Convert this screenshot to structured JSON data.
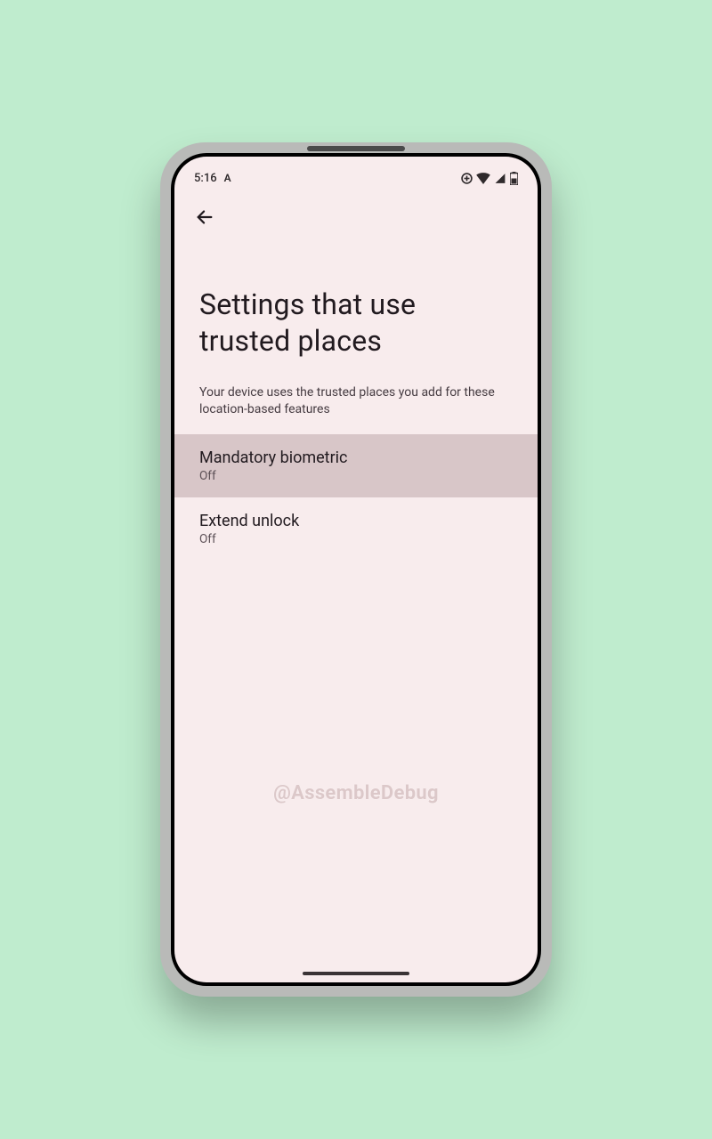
{
  "statusbar": {
    "time": "5:16",
    "carrier_glyph": "A"
  },
  "appbar": {
    "back_label": "Back"
  },
  "page": {
    "title": "Settings that use trusted places",
    "subtitle": "Your device uses the trusted places you add for these location-based features"
  },
  "items": [
    {
      "title": "Mandatory biometric",
      "status": "Off",
      "highlight": true
    },
    {
      "title": "Extend unlock",
      "status": "Off",
      "highlight": false
    }
  ],
  "watermark": "@AssembleDebug"
}
